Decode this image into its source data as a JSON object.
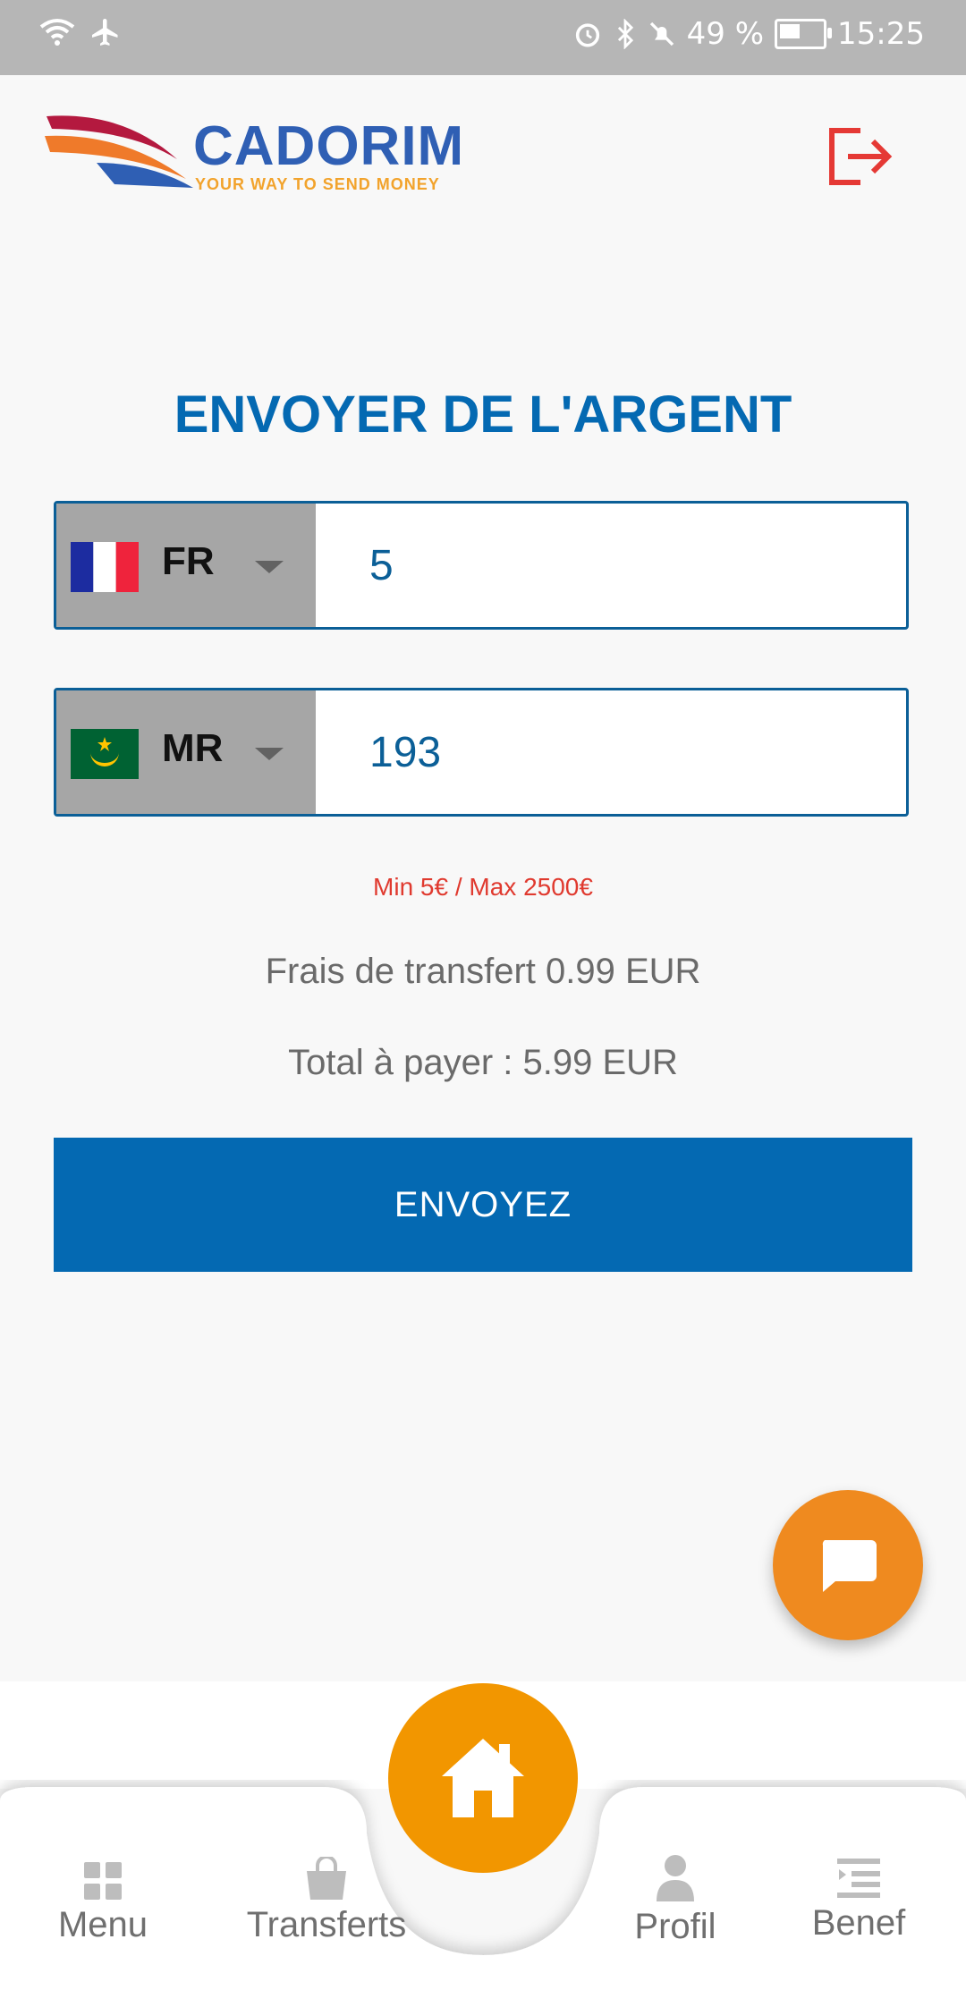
{
  "status_bar": {
    "battery_percent": "49 %",
    "time": "15:25"
  },
  "brand": {
    "name": "CADORIM",
    "tagline": "YOUR WAY TO SEND MONEY"
  },
  "page_title": "ENVOYER DE L'ARGENT",
  "send_row": {
    "country_code": "FR",
    "amount": "5"
  },
  "receive_row": {
    "country_code": "MR",
    "amount": "193"
  },
  "limits_text": "Min 5€ / Max 2500€",
  "fee_text": "Frais de transfert 0.99 EUR",
  "total_text": "Total à payer : 5.99 EUR",
  "send_button_label": "ENVOYEZ",
  "bottom_nav": {
    "menu": "Menu",
    "transferts": "Transferts",
    "profil": "Profil",
    "benef": "Benef"
  },
  "colors": {
    "primary_blue": "#0469b2",
    "accent_orange": "#f29600",
    "error_red": "#e03a2f"
  }
}
